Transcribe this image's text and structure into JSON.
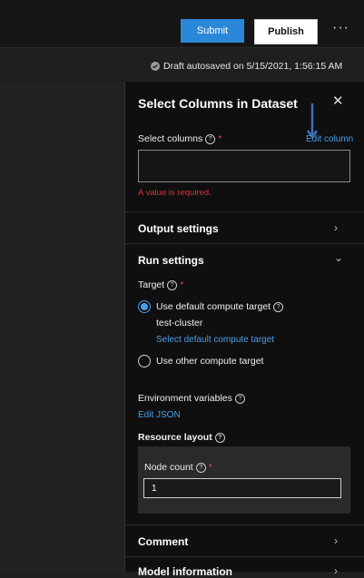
{
  "toolbar": {
    "submit_label": "Submit",
    "publish_label": "Publish",
    "more_label": "···"
  },
  "status": {
    "draft_text": "Draft autosaved on 5/15/2021, 1:56:15 AM"
  },
  "panel": {
    "title": "Select Columns in Dataset",
    "close_label": "✕",
    "select_columns_label": "Select columns",
    "edit_column_link": "Edit column",
    "error_text": "A value is required.",
    "output_settings_label": "Output settings",
    "run_settings_label": "Run settings",
    "target_label": "Target",
    "default_target_label": "Use default compute target",
    "cluster_name": "test-cluster",
    "select_default_link": "Select default compute target",
    "other_target_label": "Use other compute target",
    "env_vars_label": "Environment variables",
    "edit_json_link": "Edit JSON",
    "resource_layout_label": "Resource layout",
    "node_count_label": "Node count",
    "node_count_value": "1",
    "comment_label": "Comment",
    "model_info_label": "Model information"
  },
  "colors": {
    "accent": "#2b88d8",
    "link": "#4a9ee8",
    "error": "#d13438"
  }
}
